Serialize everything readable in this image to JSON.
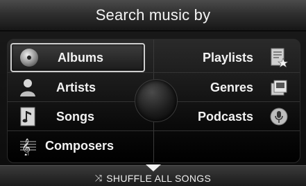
{
  "header": {
    "title": "Search music by"
  },
  "menu": {
    "left": [
      {
        "label": "Albums",
        "icon": "cd-icon",
        "selected": true
      },
      {
        "label": "Artists",
        "icon": "person-icon"
      },
      {
        "label": "Songs",
        "icon": "music-note-icon"
      },
      {
        "label": "Composers",
        "icon": "treble-clef-icon"
      }
    ],
    "right": [
      {
        "label": "Playlists",
        "icon": "playlist-star-icon"
      },
      {
        "label": "Genres",
        "icon": "genres-icon"
      },
      {
        "label": "Podcasts",
        "icon": "podcast-icon"
      }
    ]
  },
  "footer": {
    "shuffle_label": "SHUFFLE ALL SONGS",
    "shuffle_icon": "shuffle-icon",
    "scroll_icon": "down-arrow-icon"
  }
}
